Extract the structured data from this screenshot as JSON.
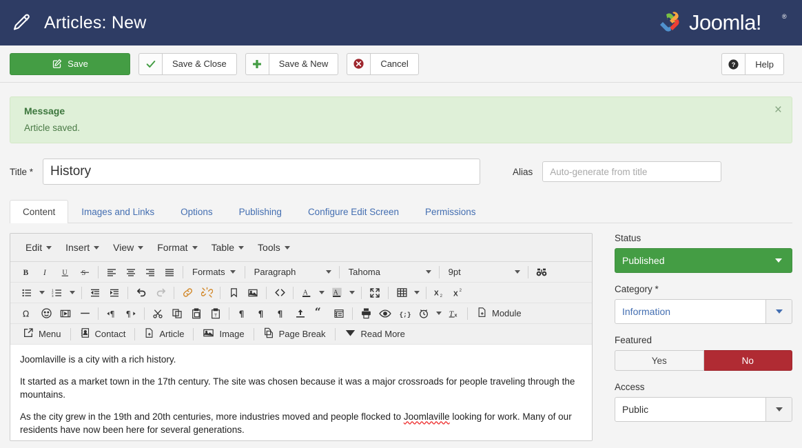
{
  "header": {
    "title": "Articles: New",
    "icon": "pencil-icon",
    "brand": "Joomla!",
    "brand_mark": "®",
    "bg_color": "#2e3c64"
  },
  "toolbar": {
    "save_label": "Save",
    "save_close_label": "Save & Close",
    "save_new_label": "Save & New",
    "cancel_label": "Cancel",
    "help_label": "Help",
    "save_color": "#449d44"
  },
  "alert": {
    "heading": "Message",
    "text": "Article saved.",
    "close_label": "×",
    "bg_color": "#dff0d8",
    "text_color": "#3c763d"
  },
  "form": {
    "title_label": "Title *",
    "title_value": "History",
    "alias_label": "Alias",
    "alias_value": "",
    "alias_placeholder": "Auto-generate from title"
  },
  "tabs": [
    {
      "label": "Content",
      "active": true
    },
    {
      "label": "Images and Links",
      "active": false
    },
    {
      "label": "Options",
      "active": false
    },
    {
      "label": "Publishing",
      "active": false
    },
    {
      "label": "Configure Edit Screen",
      "active": false
    },
    {
      "label": "Permissions",
      "active": false
    }
  ],
  "editor": {
    "menubar": [
      "Edit",
      "Insert",
      "View",
      "Format",
      "Table",
      "Tools"
    ],
    "formats_label": "Formats",
    "paragraph_label": "Paragraph",
    "font_label": "Tahoma",
    "size_label": "9pt",
    "module_label": "Module",
    "buttons_row4": [
      {
        "label": "Menu",
        "icon": "share-icon"
      },
      {
        "label": "Contact",
        "icon": "contact-card-icon"
      },
      {
        "label": "Article",
        "icon": "article-page-icon"
      },
      {
        "label": "Image",
        "icon": "image-icon"
      },
      {
        "label": "Page Break",
        "icon": "page-break-icon"
      },
      {
        "label": "Read More",
        "icon": "read-more-chevron-icon"
      }
    ],
    "body": {
      "p1": "Joomlaville is a city with a rich history.",
      "p2": "It started as a market town in the 17th century. The site was chosen because it was a major crossroads for people traveling through the mountains.",
      "p3a": "As the city grew in the 19th and 20th centuries, more industries moved and people flocked to ",
      "p3_misspelled": "Joomlaville",
      "p3b": " looking for work. Many of our residents have now been here for several generations."
    }
  },
  "sidebar": {
    "status_label": "Status",
    "status_value": "Published",
    "status_color": "#449d44",
    "category_label": "Category *",
    "category_value": "Information",
    "category_color": "#436eb1",
    "featured_label": "Featured",
    "featured_yes": "Yes",
    "featured_no": "No",
    "featured_selected": "No",
    "featured_no_color": "#b02b33",
    "access_label": "Access",
    "access_value": "Public"
  }
}
